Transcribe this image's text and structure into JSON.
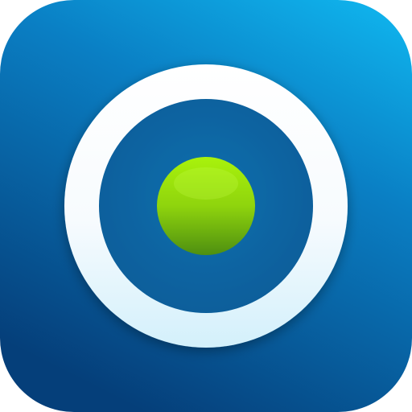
{
  "icon": {
    "name": "target-record-icon",
    "shape": "rounded-square",
    "colors": {
      "background_top": "#0fb0ea",
      "background_bottom": "#053f7a",
      "ring_top": "#ffffff",
      "ring_bottom": "#d3f0fb",
      "dot_top": "#a9f20c",
      "dot_bottom": "#4e8f10"
    }
  }
}
